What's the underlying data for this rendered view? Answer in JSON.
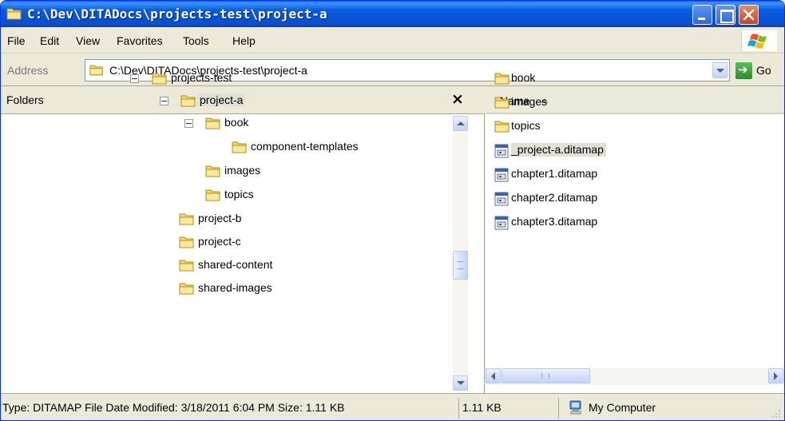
{
  "window": {
    "title": "C:\\Dev\\DITADocs\\projects-test\\project-a"
  },
  "menu": {
    "items": [
      "File",
      "Edit",
      "View",
      "Favorites",
      "Tools",
      "Help"
    ]
  },
  "address": {
    "label": "Address",
    "value": "C:\\Dev\\DITADocs\\projects-test\\project-a",
    "go_label": "Go"
  },
  "folders": {
    "title": "Folders",
    "close_glyph": "×",
    "tree": [
      {
        "label": "projects-test",
        "expanded": true
      },
      {
        "label": "project-a",
        "expanded": true,
        "selected": true
      },
      {
        "label": "book",
        "expanded": true
      },
      {
        "label": "component-templates"
      },
      {
        "label": "images"
      },
      {
        "label": "topics"
      },
      {
        "label": "project-b"
      },
      {
        "label": "project-c"
      },
      {
        "label": "shared-content"
      },
      {
        "label": "shared-images"
      }
    ]
  },
  "files": {
    "column_header": "Name",
    "items": [
      {
        "label": "book",
        "type": "folder"
      },
      {
        "label": "images",
        "type": "folder"
      },
      {
        "label": "topics",
        "type": "folder"
      },
      {
        "label": "_project-a.ditamap",
        "type": "ditamap",
        "selected": true
      },
      {
        "label": "chapter1.ditamap",
        "type": "ditamap"
      },
      {
        "label": "chapter2.ditamap",
        "type": "ditamap"
      },
      {
        "label": "chapter3.ditamap",
        "type": "ditamap"
      }
    ]
  },
  "status": {
    "details": "Type: DITAMAP File Date Modified: 3/18/2011 6:04 PM Size: 1.11 KB",
    "size": "1.11 KB",
    "zone": "My Computer"
  },
  "colors": {
    "titlebar": "#0a5ce0",
    "folder": "#f5d96b",
    "selection": "#e1dfd6"
  }
}
